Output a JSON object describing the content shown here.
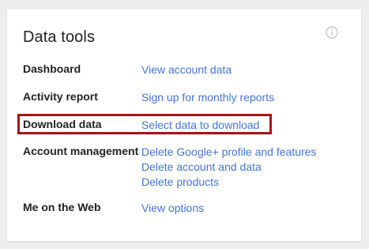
{
  "card": {
    "title": "Data tools",
    "info_icon": "info-icon",
    "highlight_color": "#a31417",
    "link_color": "#4374d8"
  },
  "rows": [
    {
      "label": "Dashboard",
      "links": [
        "View account data"
      ]
    },
    {
      "label": "Activity report",
      "links": [
        "Sign up for monthly reports"
      ]
    },
    {
      "label": "Download data",
      "links": [
        "Select data to download"
      ]
    },
    {
      "label": "Account management",
      "links": [
        "Delete Google+ profile and features",
        "Delete account and data",
        "Delete products"
      ]
    },
    {
      "label": "Me on the Web",
      "links": [
        "View options"
      ]
    }
  ]
}
